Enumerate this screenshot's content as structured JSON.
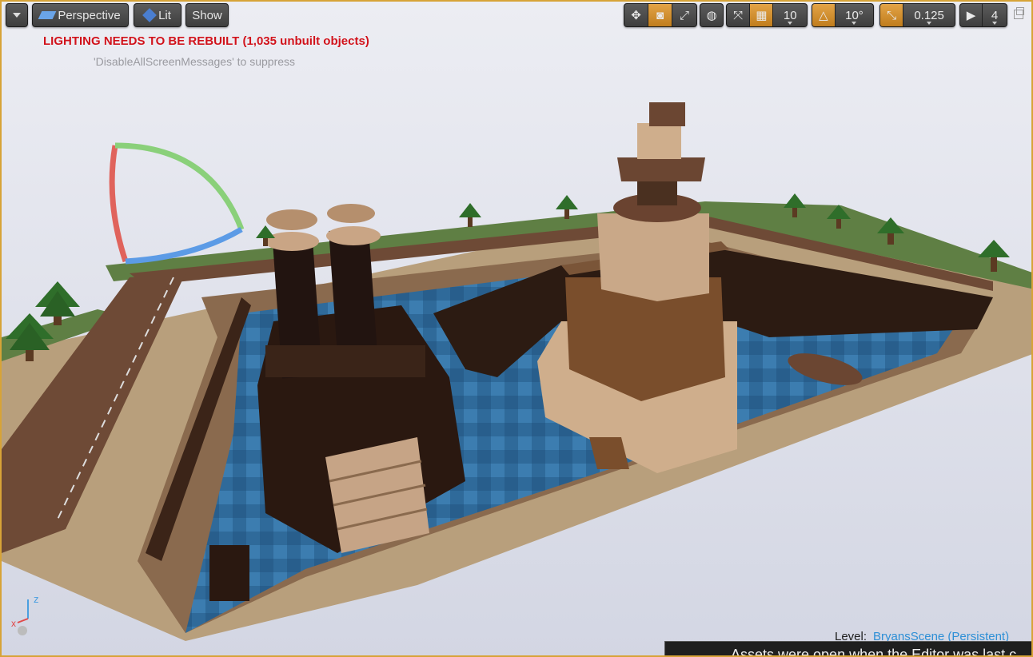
{
  "toolbar": {
    "dropdown_icon": "chevron-down-icon",
    "view_mode": "Perspective",
    "lighting_mode": "Lit",
    "show_label": "Show",
    "grid_snap_value": "10",
    "rotation_snap_value": "10°",
    "scale_snap_value": "0.125",
    "camera_speed_value": "4",
    "icons": [
      "translate-icon",
      "rotate-icon",
      "scale-icon",
      "world-space-icon",
      "surface-snap-icon",
      "grid-snap-icon",
      "rotation-snap-icon",
      "scale-snap-icon",
      "camera-speed-icon",
      "restore-viewport-icon"
    ]
  },
  "messages": {
    "lighting_warning": "LIGHTING NEEDS TO BE REBUILT (1,035 unbuilt objects)",
    "suppress_hint": "'DisableAllScreenMessages' to suppress"
  },
  "status": {
    "level_label": "Level:",
    "level_name": "BryansScene (Persistent)"
  },
  "notification": {
    "text": "Assets were open when the Editor was last c"
  },
  "colors": {
    "accent": "#d7a337",
    "warning": "#d0121b",
    "level_link": "#2d8fd6"
  }
}
